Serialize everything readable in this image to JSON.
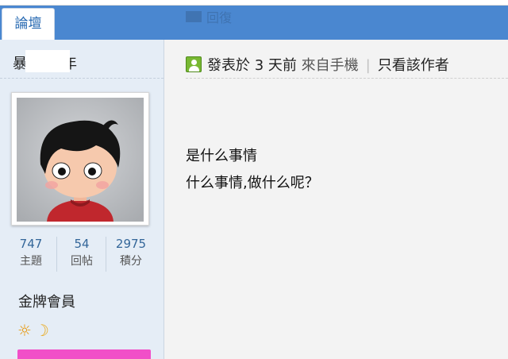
{
  "header": {
    "tab_label": "論壇",
    "ghost_text": "回復"
  },
  "sidebar": {
    "username_first_char": "暴",
    "username_last_char": "年",
    "stats": [
      {
        "value": "747",
        "label": "主題"
      },
      {
        "value": "54",
        "label": "回帖"
      },
      {
        "value": "2975",
        "label": "積分"
      }
    ],
    "rank_title": "金牌會員",
    "rank_bar_color": "#f14fc8"
  },
  "post": {
    "posted_text": "發表於 3 天前",
    "source_text": "來自手機",
    "separator": "|",
    "only_author_label": "只看該作者",
    "content_lines": [
      "是什么事情",
      "什么事情,做什么呢？"
    ]
  },
  "colors": {
    "topbar": "#4a87d0",
    "sidebar": "#e5edf6",
    "accent": "#2b6cb3"
  }
}
